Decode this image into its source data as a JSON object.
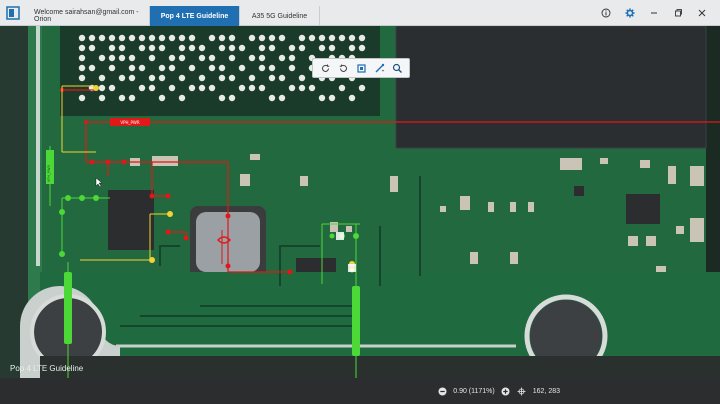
{
  "window": {
    "tabs": [
      {
        "label": "Welcome sairahsan@gmail.com - Orion"
      },
      {
        "label": "Pop 4 LTE Guideline"
      },
      {
        "label": "A35 5G Guideline"
      }
    ]
  },
  "canvas": {
    "bottom_label": "Pop 4 LTE Guideline",
    "net_label": "VPH_PWR",
    "net_label_vertical": "VPH_PWR"
  },
  "statusbar": {
    "zoom": "0.90 (1171%)",
    "coordinates": "162, 283"
  },
  "colors": {
    "board_green": "#1d5a3a",
    "trace_red": "#e01818",
    "highlight_green": "#4cd836",
    "tab_active": "#1f6fb2"
  }
}
